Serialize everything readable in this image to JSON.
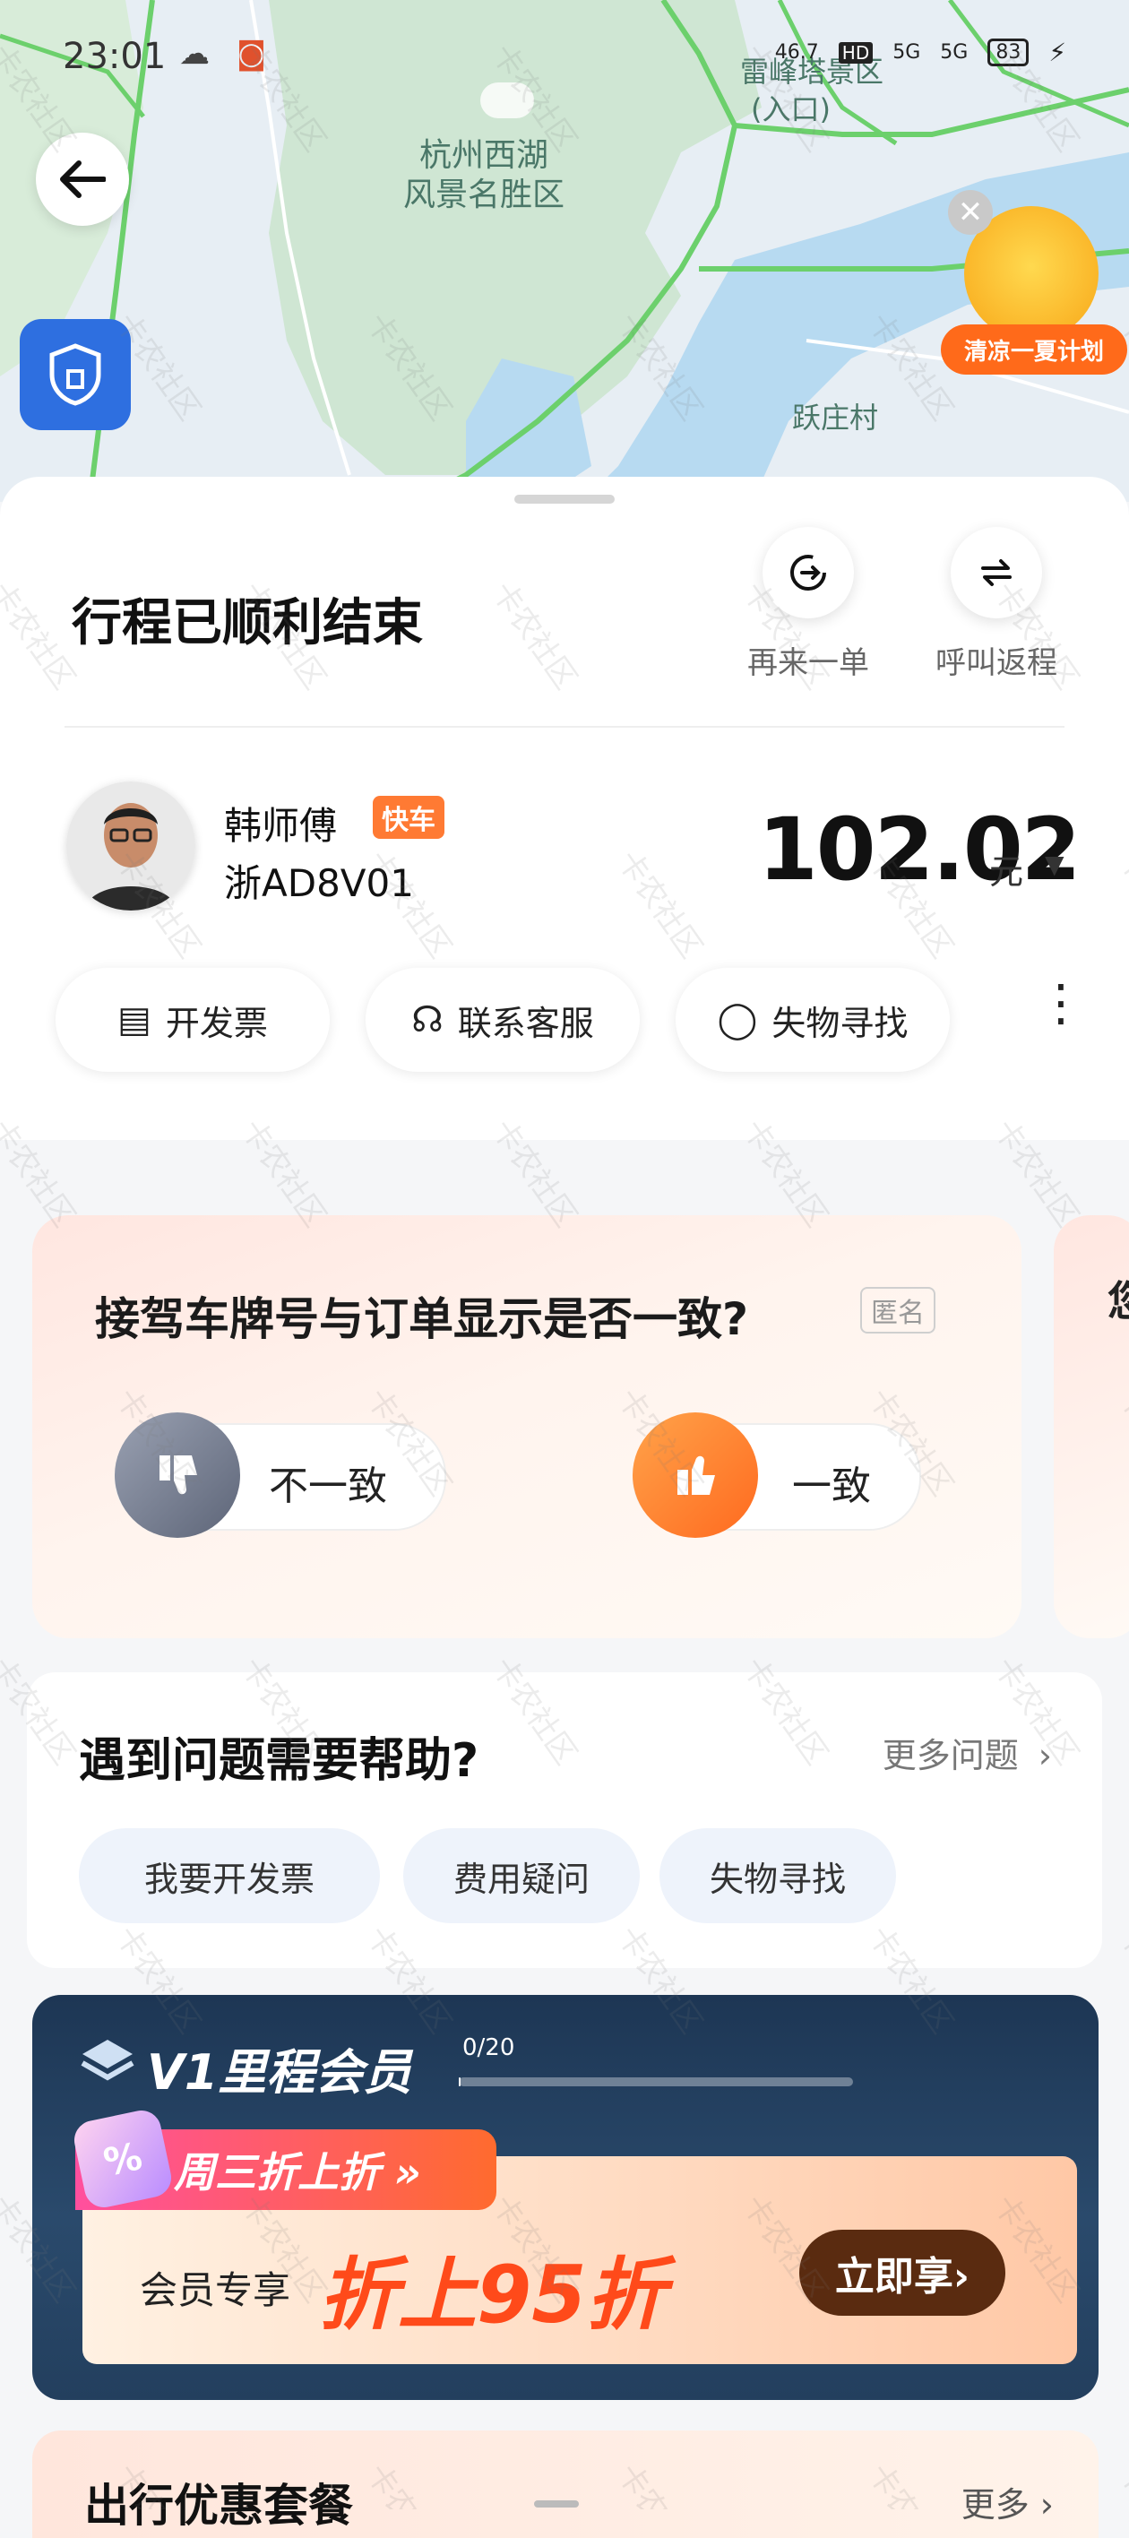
{
  "status_bar": {
    "time": "23:01",
    "network_speed": "46.7",
    "signal_labels": [
      "HD",
      "5G",
      "5G"
    ],
    "battery": "83"
  },
  "map": {
    "label_west_lake": "杭州西湖\n风景名胜区",
    "label_entrance": "(入口)",
    "label_scenic": "雷峰塔景区",
    "label_village": "跃庄村"
  },
  "promo_sticker": {
    "tag": "清凉一夏计划",
    "close": "✕"
  },
  "trip": {
    "title": "行程已顺利结束",
    "actions": [
      {
        "label": "再来一单",
        "icon": "reorder-icon"
      },
      {
        "label": "呼叫返程",
        "icon": "return-trip-icon"
      }
    ]
  },
  "driver": {
    "name": "韩师傅",
    "car_type": "快车",
    "plate": "浙AD8V01"
  },
  "fare": {
    "amount": "102.02",
    "unit": "元"
  },
  "service_pills": [
    {
      "label": "开发票",
      "icon": "invoice-icon"
    },
    {
      "label": "联系客服",
      "icon": "headset-icon"
    },
    {
      "label": "失物寻找",
      "icon": "search-icon"
    }
  ],
  "survey": {
    "question": "接驾车牌号与订单显示是否一致?",
    "anon": "匿名",
    "options": [
      {
        "label": "不一致",
        "icon": "thumbs-down-icon"
      },
      {
        "label": "一致",
        "icon": "thumbs-up-icon"
      }
    ],
    "next_peek": "您"
  },
  "help": {
    "title": "遇到问题需要帮助?",
    "more": "更多问题",
    "tags": [
      "我要开发票",
      "费用疑问",
      "失物寻找"
    ]
  },
  "member": {
    "title": "V1里程会员",
    "progress_text": "0/20",
    "progress": 0,
    "coupon_tag": "周三折上折 »",
    "coupon_prefix": "会员专享",
    "coupon_main": "折上95折",
    "coupon_button": "立即享›"
  },
  "package": {
    "title": "出行优惠套餐",
    "more": "更多 ›"
  },
  "watermark": "卡农社区",
  "colors": {
    "accent_orange": "#ff7a33",
    "brand_blue": "#2e6fe0",
    "member_navy": "#1d3654",
    "coupon_red": "#ff4a1a"
  }
}
